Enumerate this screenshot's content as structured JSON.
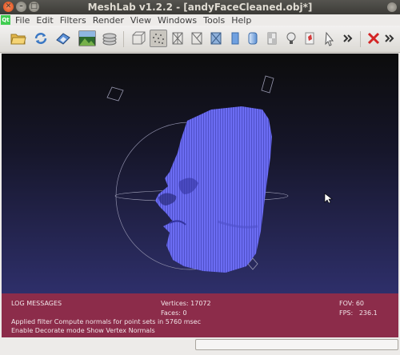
{
  "window": {
    "title": "MeshLab v1.2.2 - [andyFaceCleaned.obj*]",
    "close_glyph": "✕",
    "min_glyph": "–",
    "max_glyph": "□"
  },
  "menubar": {
    "app_icon": "Qt",
    "items": [
      {
        "label": "File"
      },
      {
        "label": "Edit"
      },
      {
        "label": "Filters"
      },
      {
        "label": "Render"
      },
      {
        "label": "View"
      },
      {
        "label": "Windows"
      },
      {
        "label": "Tools"
      },
      {
        "label": "Help"
      }
    ]
  },
  "toolbar": {
    "icons": [
      "open-folder-icon",
      "reload-icon",
      "save-snapshot-icon",
      "import-image-icon",
      "layers-icon",
      "bounding-box-icon",
      "points-icon",
      "wireframe-icon",
      "hidden-lines-icon",
      "flat-lines-icon",
      "flat-shading-icon",
      "smooth-shading-icon",
      "texture-icon",
      "light-icon",
      "color-icon",
      "pick-icon",
      "overflow-icon",
      "close-red-icon",
      "overflow-icon-2"
    ],
    "more_glyph": "»"
  },
  "colors": {
    "mesh": "#6b6cf2",
    "log_background": "#8c2c4a",
    "progress_accent": "#e0622b"
  },
  "log": {
    "header": "LOG MESSAGES",
    "messages": [
      "Applied filter Compute normals for point sets in 5760 msec",
      "Enable Decorate mode Show Vertex Normals"
    ],
    "vertices": "Vertices: 17072",
    "faces": "Faces: 0",
    "fov": "FOV: 60",
    "fps": "FPS:   236.1"
  },
  "status": {
    "progress": 0
  }
}
